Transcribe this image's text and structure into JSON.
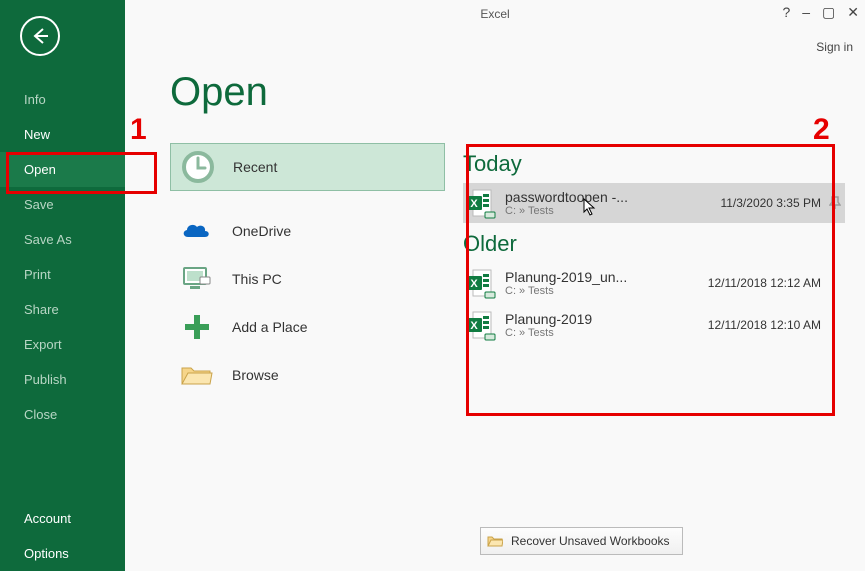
{
  "app_title": "Excel",
  "sign_in": "Sign in",
  "page_header": "Open",
  "sidebar": {
    "items": [
      {
        "label": "Info",
        "enabled": false
      },
      {
        "label": "New",
        "enabled": true
      },
      {
        "label": "Open",
        "enabled": true,
        "selected": true
      },
      {
        "label": "Save",
        "enabled": false
      },
      {
        "label": "Save As",
        "enabled": false
      },
      {
        "label": "Print",
        "enabled": false
      },
      {
        "label": "Share",
        "enabled": false
      },
      {
        "label": "Export",
        "enabled": false
      },
      {
        "label": "Publish",
        "enabled": false
      },
      {
        "label": "Close",
        "enabled": false
      }
    ],
    "bottom_items": [
      "Account",
      "Options"
    ]
  },
  "places": [
    {
      "label": "Recent",
      "icon": "clock",
      "selected": true
    },
    {
      "label": "OneDrive",
      "icon": "onedrive"
    },
    {
      "label": "This PC",
      "icon": "thispc"
    },
    {
      "label": "Add a Place",
      "icon": "add"
    },
    {
      "label": "Browse",
      "icon": "folder"
    }
  ],
  "recent": {
    "groups": [
      {
        "title": "Today",
        "files": [
          {
            "name": "passwordtoopen -...",
            "path": "C: » Tests",
            "date": "11/3/2020 3:35 PM",
            "hovered": true
          }
        ]
      },
      {
        "title": "Older",
        "files": [
          {
            "name": "Planung-2019_un...",
            "path": "C: » Tests",
            "date": "12/11/2018 12:12 AM"
          },
          {
            "name": "Planung-2019",
            "path": "C: » Tests",
            "date": "12/11/2018 12:10 AM"
          }
        ]
      }
    ]
  },
  "recover_label": "Recover Unsaved Workbooks",
  "annotations": {
    "one": "1",
    "two": "2"
  }
}
